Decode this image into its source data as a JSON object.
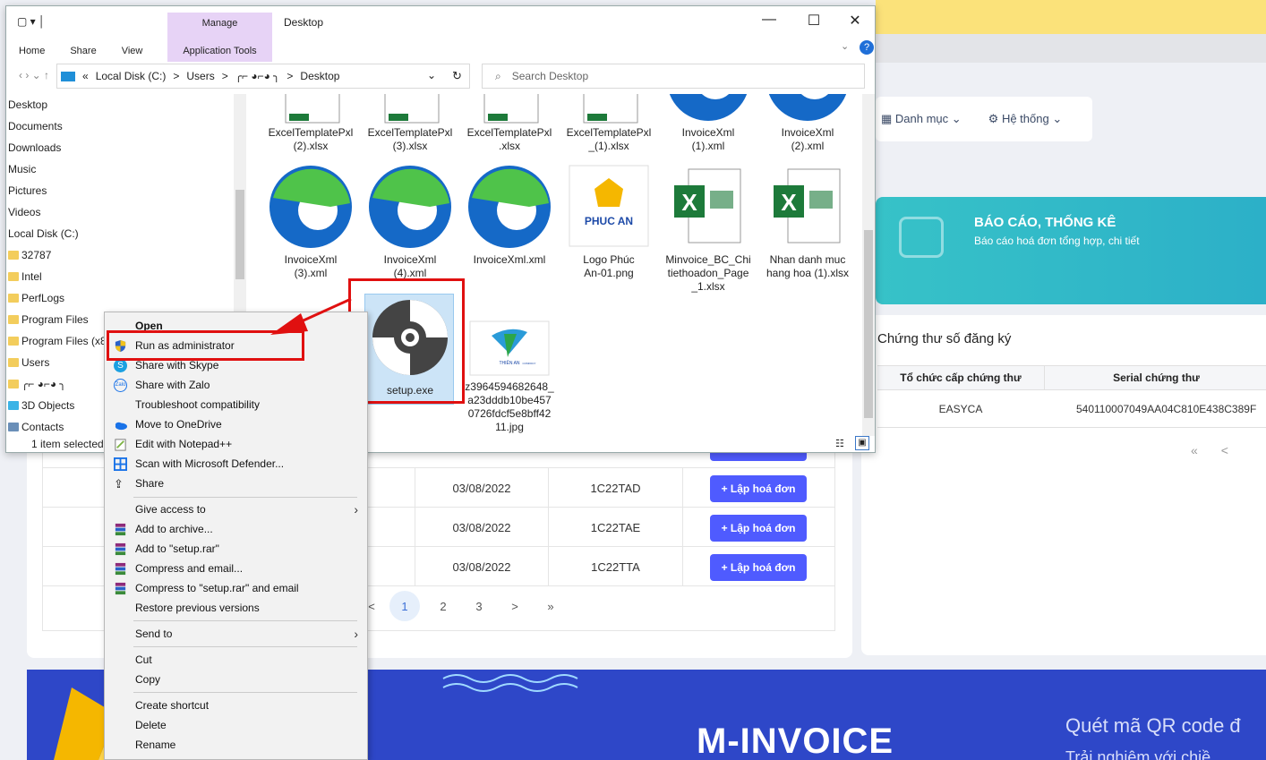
{
  "explorer": {
    "ribbon_context": "Manage",
    "title": "Desktop",
    "tabs": [
      "Home",
      "Share",
      "View"
    ],
    "app_tools": "Application Tools",
    "breadcrumb": [
      "«",
      "Local Disk (C:)",
      ">",
      "Users",
      ">",
      "╭⌐ ◕⌐◕ ╮",
      ">",
      "Desktop"
    ],
    "search_placeholder": "Search Desktop",
    "nav_items": [
      "Desktop",
      "Documents",
      "Downloads",
      "Music",
      "Pictures",
      "Videos",
      "Local Disk (C:)",
      "32787",
      "Intel",
      "PerfLogs",
      "Program Files",
      "Program Files (x86)",
      "Users",
      "╭⌐ ◕⌐◕ ╮",
      "3D Objects",
      "Contacts"
    ],
    "status": "1 item selected",
    "files_top": [
      "ExcelTemplatePxl\n(2).xlsx",
      "ExcelTemplatePxl\n(3).xlsx",
      "ExcelTemplatePxl\n.xlsx",
      "ExcelTemplatePxl\n_(1).xlsx",
      "InvoiceXml\n(1).xml",
      "InvoiceXml\n(2).xml"
    ],
    "files_mid": [
      "InvoiceXml\n(3).xml",
      "InvoiceXml\n(4).xml",
      "InvoiceXml.xml",
      "Logo Phúc\nAn-01.png",
      "Minvoice_BC_Chi\ntiethoadon_Page\n_1.xlsx",
      "Nhan danh muc\nhang hoa (1).xlsx"
    ],
    "files_bottom": [
      "setup.exe",
      "z3964594682648_\na23dddb10be457\n0726fdcf5e8bff42\n11.jpg"
    ],
    "logo_text": "PHUC AN",
    "logo_text2": "THIÊN AN",
    "logo_text3": "COMPANY"
  },
  "context_menu": {
    "items": [
      {
        "label": "Open",
        "bold": true
      },
      {
        "label": "Run as administrator",
        "icon": "shield-icon"
      },
      {
        "label": "Share with Skype",
        "icon": "skype-icon"
      },
      {
        "label": "Share with Zalo",
        "icon": "zalo-icon"
      },
      {
        "label": "Troubleshoot compatibility"
      },
      {
        "label": "Move to OneDrive",
        "icon": "onedrive-icon"
      },
      {
        "label": "Edit with Notepad++",
        "icon": "notepad-icon"
      },
      {
        "label": "Scan with Microsoft Defender...",
        "icon": "defender-icon"
      },
      {
        "label": "Share",
        "icon": "share-icon"
      },
      {
        "label": "Give access to",
        "submenu": true
      },
      {
        "label": "Add to archive...",
        "icon": "winrar-icon"
      },
      {
        "label": "Add to \"setup.rar\"",
        "icon": "winrar-icon"
      },
      {
        "label": "Compress and email...",
        "icon": "winrar-icon"
      },
      {
        "label": "Compress to \"setup.rar\" and email",
        "icon": "winrar-icon"
      },
      {
        "label": "Restore previous versions"
      },
      {
        "label": "Send to",
        "submenu": true
      },
      {
        "label": "Cut"
      },
      {
        "label": "Copy"
      },
      {
        "label": "Create shortcut"
      },
      {
        "label": "Delete"
      },
      {
        "label": "Rename"
      }
    ]
  },
  "webapp": {
    "nav": [
      "Danh mục",
      "Hệ thống"
    ],
    "banner_title": "BÁO CÁO, THỐNG KÊ",
    "banner_sub": "Báo cáo hoá đơn tổng hợp, chi tiết",
    "cert_title": "Chứng thư số đăng ký",
    "cert_headers": [
      "Tổ chức cấp chứng thư",
      "Serial chứng thư"
    ],
    "cert_row": [
      "EASYCA",
      "540110007049AA04C810E438C389F"
    ],
    "rows": [
      {
        "date": "03/08/2022",
        "code": "1C22TAD",
        "action": "+ Lập hoá đơn"
      },
      {
        "date": "03/08/2022",
        "code": "1C22TAE",
        "action": "+ Lập hoá đơn"
      },
      {
        "date": "03/08/2022",
        "code": "1C22TTA",
        "action": "+ Lập hoá đơn"
      }
    ],
    "pager": [
      "<",
      "1",
      "2",
      "3",
      ">",
      "»"
    ],
    "pager_right": [
      "«",
      "<"
    ],
    "footer_brand": "M-INVOICE",
    "footer_qr": "Quét mã QR code đ",
    "footer_qr2": "Trải nghiệm với chiề"
  },
  "colors": {
    "accent": "#4f5bff",
    "highlight": "#e01010",
    "manage": "#e7d3f6"
  }
}
